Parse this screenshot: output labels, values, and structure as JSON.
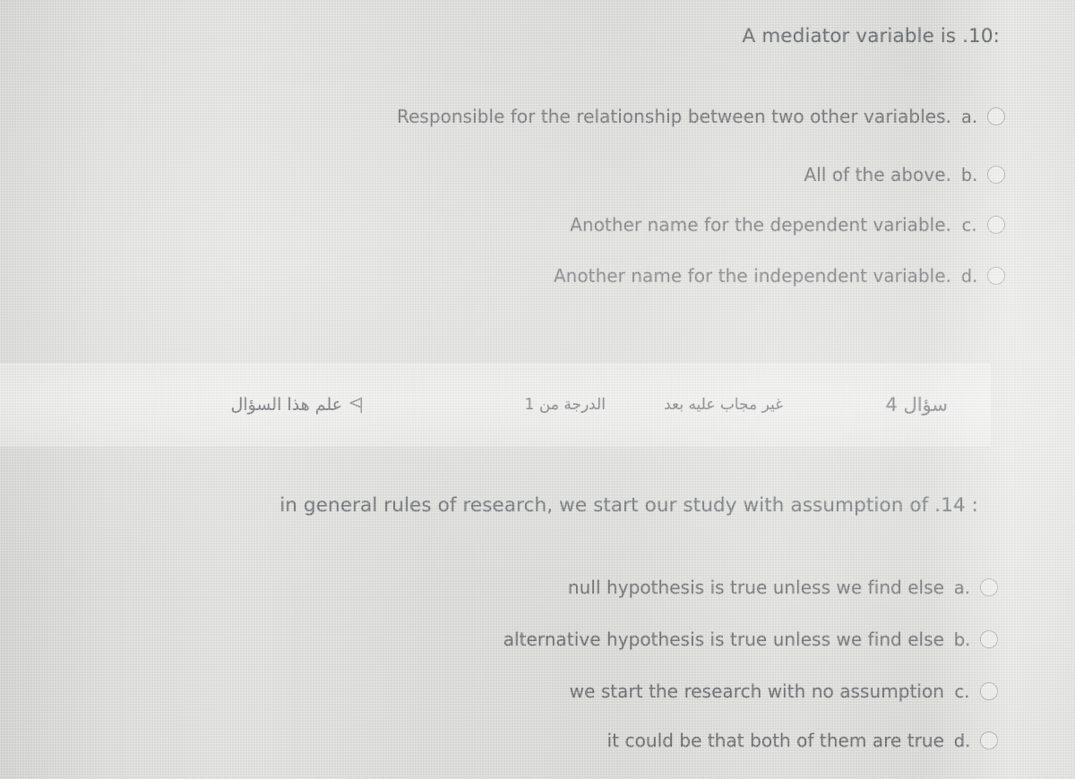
{
  "questions": [
    {
      "number_label": "10.",
      "stem": ".A mediator variable is",
      "stem_display": ":A mediator variable is .10",
      "answers": [
        {
          "key": ".a",
          "text": ".Responsible for the relationship between two other variables",
          "selected": false
        },
        {
          "key": ".b",
          "text": ".All of the above",
          "selected": false
        },
        {
          "key": ".c",
          "text": ".Another name for the dependent variable",
          "selected": false
        },
        {
          "key": ".d",
          "text": ".Another name for the independent variable",
          "selected": false
        }
      ]
    },
    {
      "number_label": "14.",
      "stem": "in general rules of research, we start our study with assumption of",
      "stem_display": ": in general rules of research, we start our study with assumption of .14",
      "answers": [
        {
          "key": ".a",
          "text": "null hypothesis is true unless we find else",
          "selected": false
        },
        {
          "key": ".b",
          "text": "alternative hypothesis is true unless we find else",
          "selected": false
        },
        {
          "key": ".c",
          "text": "we start the research with no assumption",
          "selected": false
        },
        {
          "key": ".d",
          "text": "it could be that both of them are true",
          "selected": false
        }
      ]
    }
  ],
  "info_bar": {
    "question_number": "سؤال 4",
    "state": "غير مجاب عليه بعد",
    "grade": "الدرجة من 1",
    "flag_label": "علم هذا السؤال",
    "flag_icon": "flag-icon"
  },
  "colors": {
    "background": "#d9d9d7",
    "text": "#67696b",
    "radio_border": "#a9abac",
    "band_highlight": "#e8e8e6"
  }
}
